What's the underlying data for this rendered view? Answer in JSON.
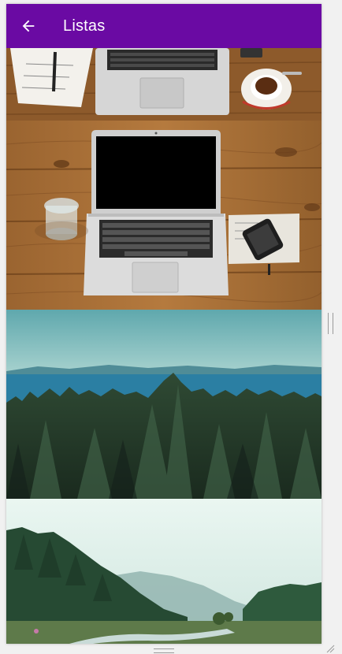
{
  "app": {
    "title": "Listas",
    "accent": "#6a0aa3"
  },
  "toolbar": {
    "back_icon": "arrow-left-icon"
  },
  "list": {
    "items": [
      {
        "subject": "laptop-desk-coffee"
      },
      {
        "subject": "laptop-desk-phone"
      },
      {
        "subject": "forest-lake"
      },
      {
        "subject": "misty-valley-river"
      }
    ]
  }
}
